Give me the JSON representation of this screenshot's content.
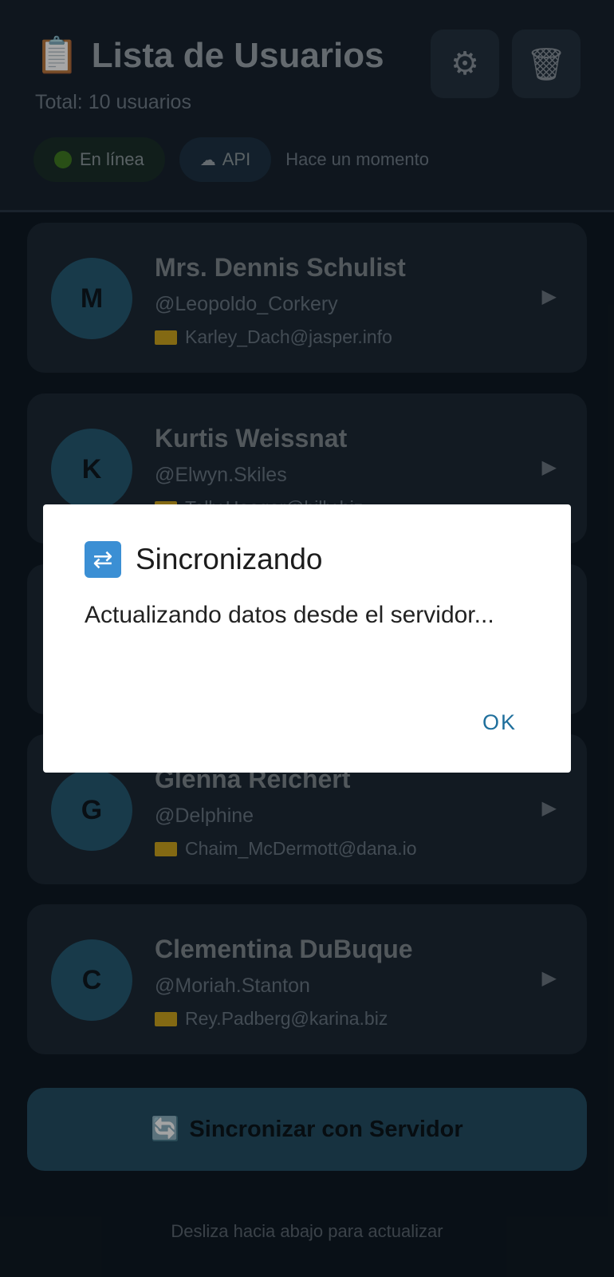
{
  "header": {
    "title_icon": "📋",
    "title": "Lista de Usuarios",
    "subtitle": "Total: 10 usuarios",
    "settings_icon": "⚙",
    "trash_icon": "🗑",
    "status_online": "En línea",
    "status_api": "API",
    "last_sync": "Hace un momento"
  },
  "users": [
    {
      "initial": "M",
      "name": "Mrs. Dennis Schulist",
      "handle": "@Leopoldo_Corkery",
      "email": "Karley_Dach@jasper.info"
    },
    {
      "initial": "K",
      "name": "Kurtis Weissnat",
      "handle": "@Elwyn.Skiles",
      "email": "Telly.Hoeger@billy.biz"
    },
    {
      "initial": "G",
      "name": "Glenna Reichert",
      "handle": "@Delphine",
      "email": "Chaim_McDermott@dana.io"
    },
    {
      "initial": "C",
      "name": "Clementina DuBuque",
      "handle": "@Moriah.Stanton",
      "email": "Rey.Padberg@karina.biz"
    }
  ],
  "arrow": "▶",
  "sync_button": {
    "icon": "🔄",
    "label": "Sincronizar con Servidor"
  },
  "footer_hint": "Desliza hacia abajo para actualizar",
  "dialog": {
    "icon": "🔄",
    "title": "Sincronizando",
    "message": "Actualizando datos desde el servidor...",
    "ok": "OK"
  },
  "colors": {
    "background": "#0f1a24",
    "card": "#1c2835",
    "avatar": "#265a72",
    "accent": "#244e63",
    "dialog_button": "#1f6f9c"
  }
}
